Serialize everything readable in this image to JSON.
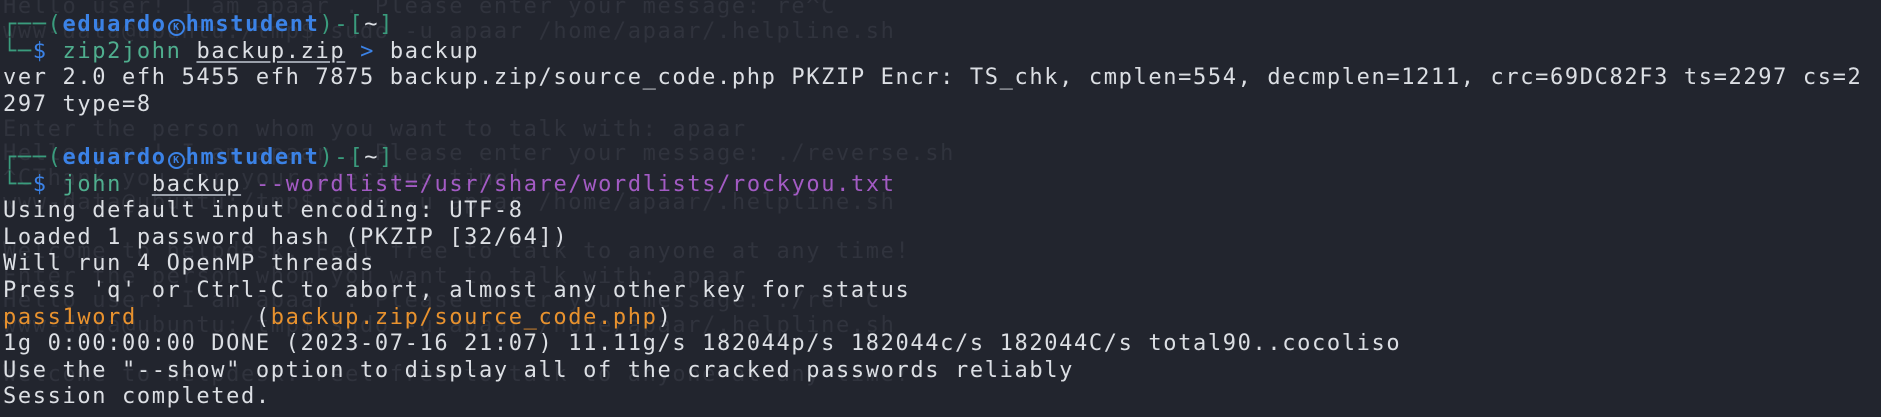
{
  "colors": {
    "background": "#22252e",
    "text": "#dcdfe4",
    "prompt_frame": "#3a9c7d",
    "prompt_user": "#3b82e6",
    "command": "#4fae8e",
    "option": "#a35bc4",
    "cracked_password": "#e8922e",
    "background_window_text": "#30333d"
  },
  "background_window": {
    "lines": [
      "Hello user! I am apaar . Please enter your message: re^C",
      "www-data@ubuntu:/tmp$ sudo -u apaar /home/apaar/.helpline.sh",
      "",
      "",
      "",
      "Enter the person whom you want to talk with: apaar",
      "Hello user! I am apaar . Please enter your message: ./reverse.sh",
      "^CThank you for your precious time!",
      "www-data@ubuntu:/tmp$ sudo -u apaar /home/apaar/.helpline.sh",
      "",
      "Welcome to helpdesk. Feel free to talk to anyone at any time!",
      "Enter the person whom you want to talk with: apaar",
      "Hello user! I am apaar . Please enter your message: ./rer^C",
      "www-data@ubuntu:/tmp$ sudo -u apaar /home/apaar/.helpline.sh",
      "",
      "Welcome to helpdesk. Feel free to talk to anyone at any time!"
    ]
  },
  "prompt": {
    "frame_top": "┌──(",
    "user": "eduardo",
    "at_icon": "kali-skull-icon",
    "at_glyph": "K",
    "host": "hmstudent",
    "frame_mid": ")-[",
    "cwd": "~",
    "frame_end": "]",
    "frame_bottom": "└─",
    "symbol": "$"
  },
  "commands": [
    {
      "program": "zip2john",
      "argument": "backup.zip",
      "redirect": ">",
      "target": "backup",
      "output": [
        "ver 2.0 efh 5455 efh 7875 backup.zip/source_code.php PKZIP Encr: TS_chk, cmplen=554, decmplen=1211, crc=69DC82F3 ts=2297 cs=2",
        "297 type=8"
      ]
    },
    {
      "program": "john",
      "argument": "backup",
      "option": "--wordlist=/usr/share/wordlists/rockyou.txt",
      "output_before": [
        "Using default input encoding: UTF-8",
        "Loaded 1 password hash (PKZIP [32/64])",
        "Will run 4 OpenMP threads",
        "Press 'q' or Ctrl-C to abort, almost any other key for status"
      ],
      "cracked": {
        "password": "pass1word",
        "open_paren": "(",
        "source": "backup.zip/source_code.php",
        "close_paren": ")"
      },
      "output_after": [
        "1g 0:00:00:00 DONE (2023-07-16 21:07) 11.11g/s 182044p/s 182044c/s 182044C/s total90..cocoliso",
        "Use the \"--show\" option to display all of the cracked passwords reliably",
        "Session completed."
      ]
    }
  ]
}
